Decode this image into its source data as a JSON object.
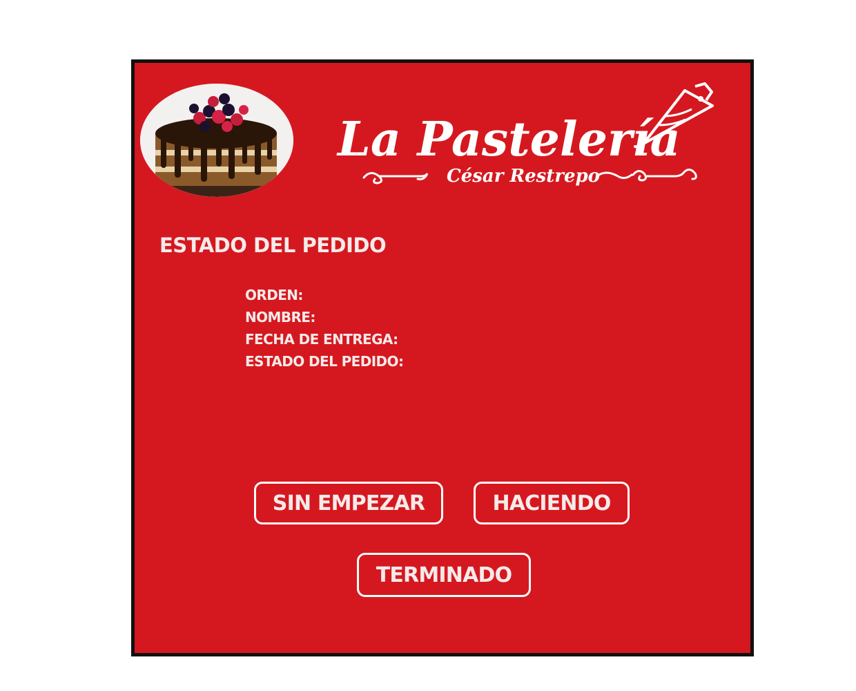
{
  "brand": {
    "name": "La Pastelería",
    "owner": "César Restrepo"
  },
  "page": {
    "heading": "ESTADO DEL PEDIDO"
  },
  "fields": [
    {
      "label": "ORDEN:",
      "value": ""
    },
    {
      "label": "NOMBRE:",
      "value": ""
    },
    {
      "label": "FECHA DE ENTREGA:",
      "value": ""
    },
    {
      "label": "ESTADO DEL PEDIDO:",
      "value": ""
    }
  ],
  "status_buttons": {
    "not_started": "SIN EMPEZAR",
    "in_progress": "HACIENDO",
    "finished": "TERMINADO"
  },
  "colors": {
    "background": "#d5181f",
    "frame": "#111111",
    "text": "#f6eaea",
    "button_border": "#ffffff"
  },
  "icons": {
    "cake": "cake-photo",
    "piping_bag": "piping-bag-icon"
  }
}
